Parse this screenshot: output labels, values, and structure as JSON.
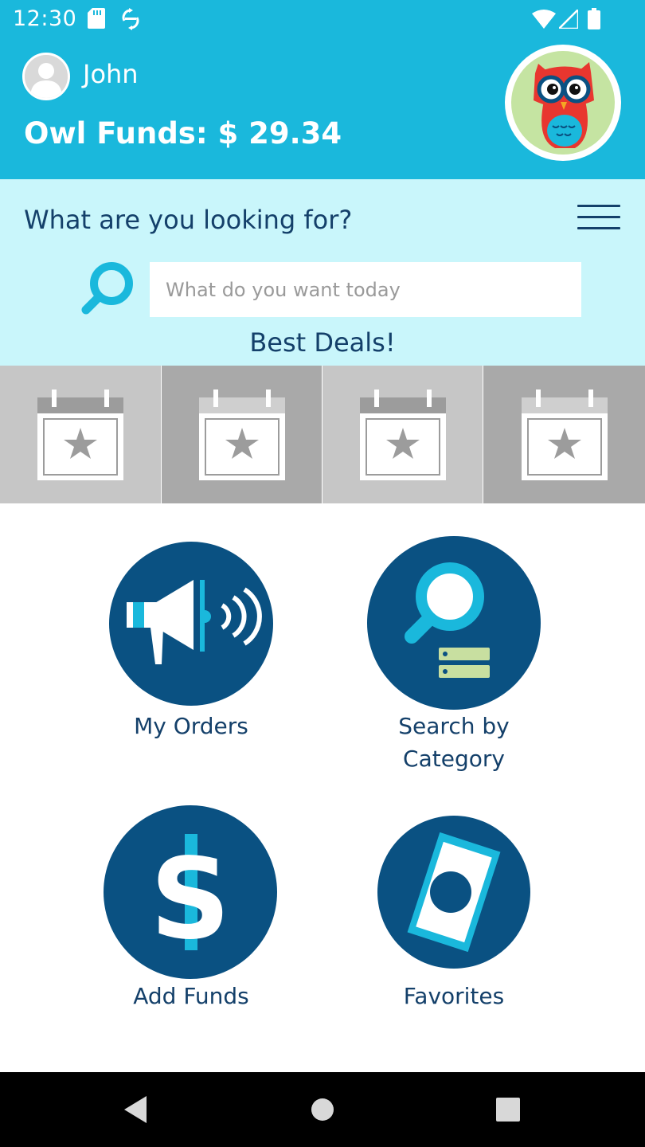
{
  "status_bar": {
    "time": "12:30",
    "icons": [
      "sd-card-icon",
      "sync-icon",
      "wifi-icon",
      "signal-icon",
      "battery-icon"
    ]
  },
  "header": {
    "user_name": "John",
    "funds_label": "Owl Funds: $ 29.34",
    "avatar_icon": "person-icon",
    "mascot": "owl-mascot"
  },
  "search": {
    "question": "What are you looking for?",
    "placeholder": "What do you want today",
    "best_deals": "Best Deals!"
  },
  "deals": [
    {
      "icon": "calendar-star-icon",
      "color": "#c6c6c6"
    },
    {
      "icon": "calendar-star-icon",
      "color": "#a9a9a9"
    },
    {
      "icon": "calendar-star-icon",
      "color": "#c6c6c6"
    },
    {
      "icon": "calendar-star-icon",
      "color": "#a9a9a9"
    }
  ],
  "menu": {
    "my_orders": "My Orders",
    "search_by_category_line1": "Search by",
    "search_by_category_line2": "Category",
    "add_funds": "Add Funds",
    "favorites": "Favorites"
  },
  "colors": {
    "header_bg": "#1ab8dc",
    "search_bg": "#c9f6fb",
    "navy": "#14406a",
    "circle": "#0a5182",
    "accent_blue": "#1ab8dc",
    "accent_green": "#c8dfa0"
  }
}
